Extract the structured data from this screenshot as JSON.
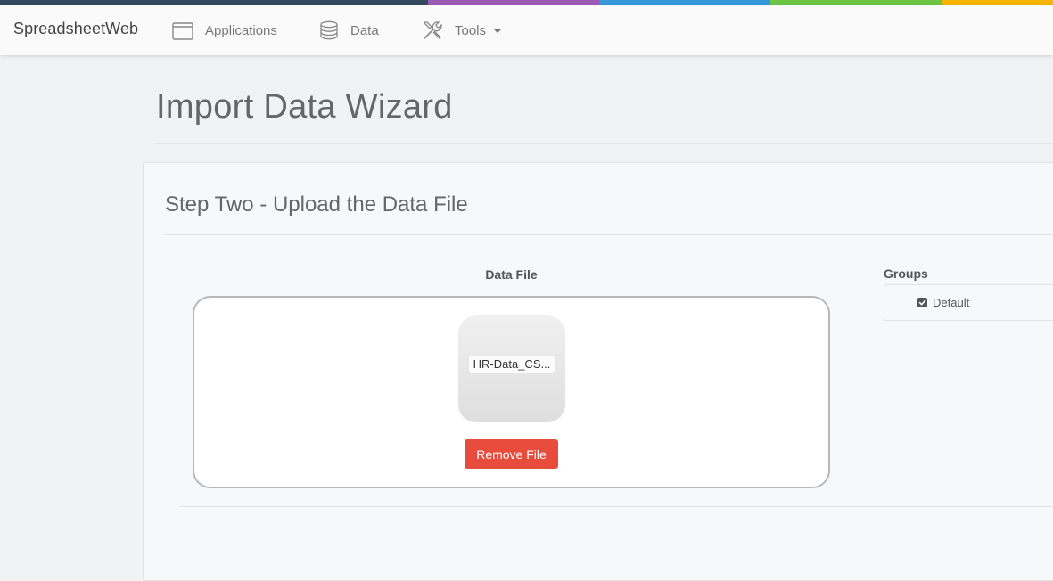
{
  "colors": {
    "bar": [
      "#34495e",
      "#9b59b6",
      "#3498db",
      "#2ecc71",
      "#f39c12"
    ],
    "remove_button": "#e74c3c"
  },
  "navbar": {
    "brand": "SpreadsheetWeb",
    "items": [
      {
        "label": "Applications",
        "icon": "window-icon"
      },
      {
        "label": "Data",
        "icon": "database-icon"
      },
      {
        "label": "Tools",
        "icon": "tools-icon",
        "dropdown": true
      }
    ]
  },
  "page": {
    "title": "Import Data Wizard"
  },
  "step": {
    "title": "Step Two - Upload the Data File",
    "data_file_label": "Data File",
    "file_name": "HR-Data_CS...",
    "remove_label": "Remove File",
    "groups_label": "Groups",
    "groups": [
      {
        "label": "Default",
        "checked": true
      }
    ]
  }
}
